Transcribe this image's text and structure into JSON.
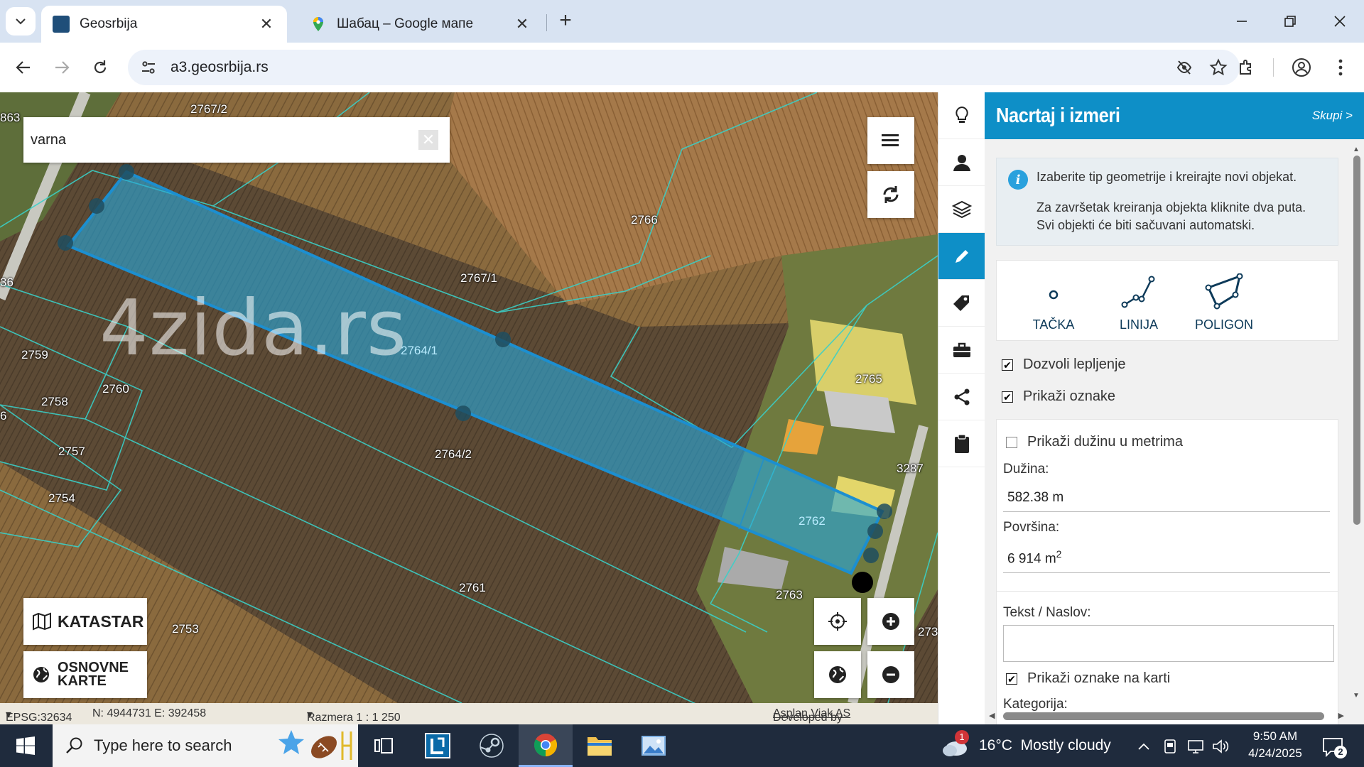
{
  "browser": {
    "tabs": [
      {
        "title": "Geosrbija",
        "active": true,
        "favicon": "geosrbija-favicon"
      },
      {
        "title": "Шабац – Google мапе",
        "active": false,
        "favicon": "google-maps-pin-icon"
      }
    ],
    "url": "a3.geosrbija.rs"
  },
  "map": {
    "search": {
      "value": "varna"
    },
    "watermark": "4zida.rs",
    "parcels": [
      {
        "id": "2767/2"
      },
      {
        "id": "863"
      },
      {
        "id": "2766"
      },
      {
        "id": "2767/1"
      },
      {
        "id": "36"
      },
      {
        "id": "2764/1",
        "selected": true
      },
      {
        "id": "2759"
      },
      {
        "id": "2760"
      },
      {
        "id": "2758"
      },
      {
        "id": "6"
      },
      {
        "id": "2765"
      },
      {
        "id": "2757"
      },
      {
        "id": "2764/2"
      },
      {
        "id": "2754"
      },
      {
        "id": "3287"
      },
      {
        "id": "2762",
        "selected": true
      },
      {
        "id": "2761"
      },
      {
        "id": "2763"
      },
      {
        "id": "2753"
      },
      {
        "id": "273"
      }
    ],
    "layer_buttons": {
      "cadastre": "KATASTAR",
      "basemaps_line1": "OSNOVNE",
      "basemaps_line2": "KARTE"
    },
    "footer": {
      "projection": "EPSG:32634",
      "coordinates": "N: 4944731 E: 392458",
      "scale": "Razmera 1 : 1 250",
      "developed_by": "Developed by",
      "developer": "Asplan Viak AS"
    }
  },
  "panel": {
    "title": "Nacrtaj i izmeri",
    "collapse_label": "Skupi >",
    "info_line1": "Izaberite tip geometrije i kreirajte novi objekat.",
    "info_line2": "Za završetak kreiranja objekta kliknite dva puta.",
    "info_line3": "Svi objekti će biti sačuvani automatski.",
    "geometry_types": [
      {
        "label": "TAČKA",
        "icon": "point-icon"
      },
      {
        "label": "LINIJA",
        "icon": "line-icon"
      },
      {
        "label": "POLIGON",
        "icon": "polygon-icon"
      }
    ],
    "allow_snapping": {
      "label": "Dozvoli lepljenje",
      "checked": true
    },
    "show_labels": {
      "label": "Prikaži oznake",
      "checked": true
    },
    "show_length_meters": {
      "label": "Prikaži dužinu u metrima",
      "checked": false
    },
    "length": {
      "label": "Dužina:",
      "value": "582.38 m"
    },
    "area": {
      "label": "Površina:",
      "value": "6 914 m",
      "unit_sup": "2"
    },
    "text_title": {
      "label": "Tekst / Naslov:",
      "value": ""
    },
    "show_labels_on_map": {
      "label": "Prikaži oznake na karti",
      "checked": true
    },
    "category": {
      "label": "Kategorija:"
    }
  },
  "taskbar": {
    "search_placeholder": "Type here to search",
    "weather": "16°C  Mostly cloudy",
    "weather_badge": "1",
    "time": "9:50 AM",
    "date": "4/24/2025",
    "notifications": "2"
  },
  "colors": {
    "accent": "#0e8fc7",
    "selection_fill": "#2aa6d8",
    "taskbar": "#1f2b3d"
  }
}
